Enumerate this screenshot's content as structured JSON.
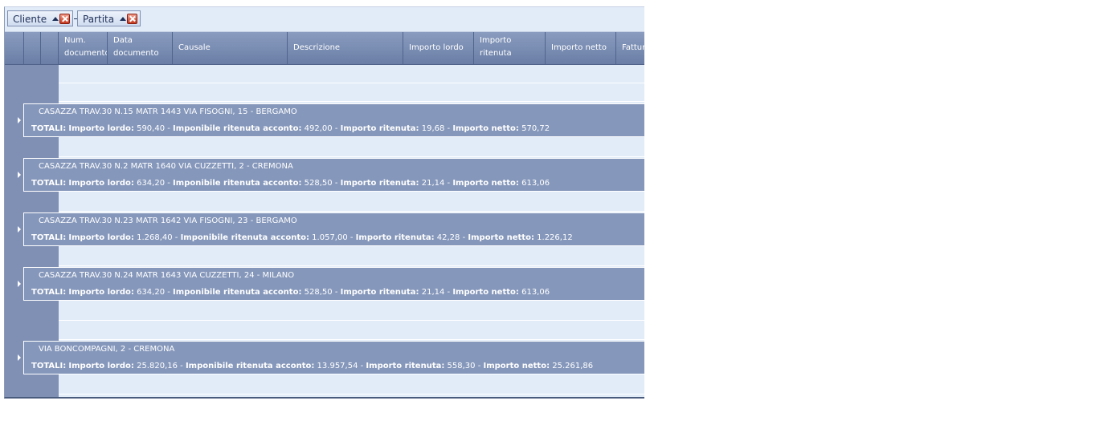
{
  "group_panel": {
    "chips": [
      {
        "label": "Cliente"
      },
      {
        "label": "Partita"
      }
    ],
    "separator": "-"
  },
  "columns": [
    {
      "label_line1": "",
      "label_line2": ""
    },
    {
      "label_line1": "",
      "label_line2": ""
    },
    {
      "label_line1": "",
      "label_line2": ""
    },
    {
      "label_line1": "Num.",
      "label_line2": "documento"
    },
    {
      "label_line1": "Data",
      "label_line2": "documento"
    },
    {
      "label_line1": "Causale",
      "label_line2": ""
    },
    {
      "label_line1": "Descrizione",
      "label_line2": ""
    },
    {
      "label_line1": "Importo lordo",
      "label_line2": ""
    },
    {
      "label_line1": "Importo",
      "label_line2": "ritenuta"
    },
    {
      "label_line1": "Importo netto",
      "label_line2": ""
    },
    {
      "label_line1": "Fattura",
      "label_line2": ""
    }
  ],
  "totals_labels": {
    "prefix": "TOTALI:",
    "lordo": "Importo lordo:",
    "imponibile": "Imponibile ritenuta acconto:",
    "ritenuta": "Importo ritenuta:",
    "netto": "Importo netto:",
    "sep": " - "
  },
  "groups": [
    {
      "title": "CASAZZA TRAV.30 N.15 MATR 1443 VIA FISOGNI, 15 - BERGAMO",
      "lordo": "590,40",
      "imponibile": "492,00",
      "ritenuta": "19,68",
      "netto": "570,72"
    },
    {
      "title": "CASAZZA TRAV.30 N.2 MATR 1640 VIA CUZZETTI, 2 - CREMONA",
      "lordo": "634,20",
      "imponibile": "528,50",
      "ritenuta": "21,14",
      "netto": "613,06"
    },
    {
      "title": "CASAZZA TRAV.30 N.23 MATR 1642 VIA FISOGNI, 23 - BERGAMO",
      "lordo": "1.268,40",
      "imponibile": "1.057,00",
      "ritenuta": "42,28",
      "netto": "1.226,12"
    },
    {
      "title": "CASAZZA TRAV.30 N.24 MATR 1643 VIA CUZZETTI, 24 - MILANO",
      "lordo": "634,20",
      "imponibile": "528,50",
      "ritenuta": "21,14",
      "netto": "613,06"
    },
    {
      "title": "VIA BONCOMPAGNI, 2 - CREMONA",
      "lordo": "25.820,16",
      "imponibile": "13.957,54",
      "ritenuta": "558,30",
      "netto": "25.261,86"
    }
  ]
}
